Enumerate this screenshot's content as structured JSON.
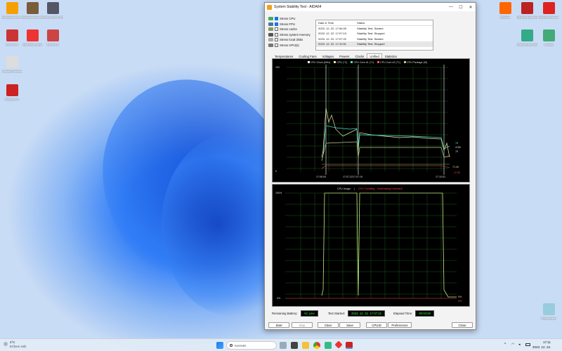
{
  "desktop_left": [
    {
      "label": "Cinebench Rel. 7",
      "color": "#f5a000"
    },
    {
      "label": "Sharpshooter 3D",
      "color": "#7a5b3a"
    },
    {
      "label": "PUBG BATTLEG.",
      "color": "#556"
    },
    {
      "label": "Far Cry 5",
      "color": "#c33"
    },
    {
      "label": "Mad Max Gang",
      "color": "#e33"
    },
    {
      "label": "Far Cry 6",
      "color": "#c44"
    },
    {
      "label": "Cocktail Fortress",
      "color": "#ddd"
    },
    {
      "label": "Rocket FIT",
      "color": "#c22"
    }
  ],
  "desktop_right": [
    {
      "label": "3DMark",
      "color": "#f60"
    },
    {
      "label": "AIDA64 Benchmark",
      "color": "#b22"
    },
    {
      "label": "AIDA64 Extreme",
      "color": "#d22"
    },
    {
      "label": "SoftwareInfo GAP-Z",
      "color": "#3a8"
    },
    {
      "label": "Crystal",
      "color": "#4a7"
    },
    {
      "label": "Recycle Bin",
      "color": "#9cd"
    }
  ],
  "window": {
    "title": "System Stability Test - AIDA64",
    "min": "—",
    "max": "☐",
    "close": "✕",
    "checks": [
      {
        "label": "Stress CPU",
        "on": true
      },
      {
        "label": "Stress FPU",
        "on": true
      },
      {
        "label": "Stress cache",
        "on": false
      },
      {
        "label": "Stress system memory",
        "on": false
      },
      {
        "label": "Stress local disks",
        "on": false
      },
      {
        "label": "Stress GPU(s)",
        "on": false
      }
    ],
    "log_headers": [
      "Date & Time",
      "Status"
    ],
    "log": [
      [
        "2023. 12. 22. 17:06:09",
        "Stability Test: Started"
      ],
      [
        "2023. 12. 22. 17:07:19",
        "Stability Test: Stopped"
      ],
      [
        "2023. 12. 22. 17:07:22",
        "Stability Test: Started"
      ],
      [
        "2023. 12. 22. 17:10:51",
        "Stability Test: Stopped"
      ]
    ],
    "tabs": [
      "Temperatures",
      "Cooling Fans",
      "Voltages",
      "Powers",
      "Clocks",
      "Unified",
      "Statistics"
    ],
    "chart1": {
      "legend": [
        "CPU Clock (MHz)",
        "CPU (°C)",
        "CPU Core #1 (°C)",
        "CPU Core #2 (°C)",
        "CPU Package (W)"
      ],
      "legend_colors": [
        "#ffffff",
        "#e8e8a0",
        "#50e0d0",
        "#ff5050",
        "#c8c890"
      ],
      "y_top": "100",
      "y_bot": "0",
      "x_labels": [
        "17:06:09",
        "17:07:2217:07:19",
        "17:10:51"
      ],
      "r1": "4780",
      "r2": "78",
      "r3": "75",
      "r4": "73.56",
      "r5": "17.92"
    },
    "chart2": {
      "title_a": "CPU Usage",
      "sep": "|",
      "title_b": "CPU Throttling - Overheating Detected!",
      "y_top": "100%",
      "y_bot": "0%",
      "r1": "0%",
      "r2": "0%"
    },
    "status": {
      "battery_label": "Remaining Battery:",
      "battery": "AC Line",
      "started_label": "Test Started:",
      "started": "2023. 12. 22. 17:07:22",
      "elapsed_label": "Elapsed Time:",
      "elapsed": "00:03:29"
    },
    "buttons": {
      "start": "Start",
      "stop": "Stop",
      "clear": "Clear",
      "save": "Save",
      "cpuid": "CPUID",
      "prefs": "Preferences",
      "close": "Close"
    }
  },
  "taskbar": {
    "weather_temp": "4°C",
    "weather_desc": "Erősen esik",
    "search": "Keresés",
    "time": "17:11",
    "date": "2023. 12. 22."
  }
}
